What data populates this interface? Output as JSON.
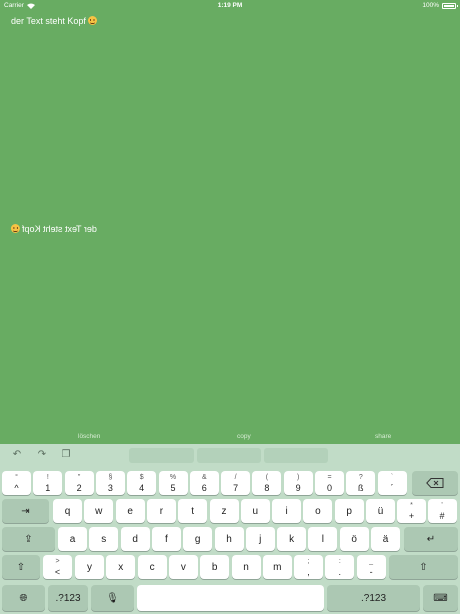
{
  "status_bar": {
    "carrier": "Carrier",
    "time": "1:19 PM",
    "battery": "100%"
  },
  "content": {
    "text": "der Text steht Kopf",
    "text_flipped": "der Text steht Kopf"
  },
  "actions": {
    "left": "löschen",
    "center": "copy",
    "right": "share"
  },
  "keyboard": {
    "row1": [
      {
        "top": "°",
        "bottom": "^"
      },
      {
        "top": "!",
        "bottom": "1"
      },
      {
        "top": "\"",
        "bottom": "2"
      },
      {
        "top": "§",
        "bottom": "3"
      },
      {
        "top": "$",
        "bottom": "4"
      },
      {
        "top": "%",
        "bottom": "5"
      },
      {
        "top": "&",
        "bottom": "6"
      },
      {
        "top": "/",
        "bottom": "7"
      },
      {
        "top": "(",
        "bottom": "8"
      },
      {
        "top": ")",
        "bottom": "9"
      },
      {
        "top": "=",
        "bottom": "0"
      },
      {
        "top": "?",
        "bottom": "ß"
      },
      {
        "top": "`",
        "bottom": "´"
      }
    ],
    "row2": [
      "q",
      "w",
      "e",
      "r",
      "t",
      "z",
      "u",
      "i",
      "o",
      "p",
      "ü"
    ],
    "row2_extra": [
      {
        "top": "*",
        "bottom": "+"
      },
      {
        "top": "'",
        "bottom": "#"
      }
    ],
    "row3": [
      "a",
      "s",
      "d",
      "f",
      "g",
      "h",
      "j",
      "k",
      "l",
      "ö",
      "ä"
    ],
    "row4_first": {
      "top": ">",
      "bottom": "<"
    },
    "row4": [
      "y",
      "x",
      "c",
      "v",
      "b",
      "n",
      "m"
    ],
    "row4_extra": [
      {
        "top": ";",
        "bottom": ","
      },
      {
        "top": ":",
        "bottom": "."
      },
      {
        "top": "_",
        "bottom": "-"
      }
    ],
    "numbers_label": ".?123"
  }
}
